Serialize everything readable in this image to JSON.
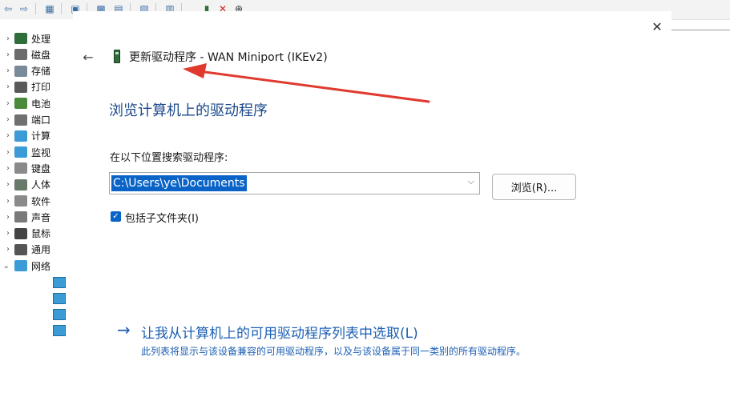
{
  "device_manager": {
    "tree": [
      {
        "label": "处理",
        "expanded": false,
        "color": "#2f6e3a"
      },
      {
        "label": "磁盘",
        "expanded": false,
        "color": "#6b6b6b"
      },
      {
        "label": "存储",
        "expanded": false,
        "color": "#7a8a9a"
      },
      {
        "label": "打印",
        "expanded": false,
        "color": "#5a5a5a"
      },
      {
        "label": "电池",
        "expanded": false,
        "color": "#4a8a3a"
      },
      {
        "label": "端口",
        "expanded": false,
        "color": "#707070"
      },
      {
        "label": "计算",
        "expanded": false,
        "color": "#3a9bd6"
      },
      {
        "label": "监视",
        "expanded": false,
        "color": "#3a9bd6"
      },
      {
        "label": "键盘",
        "expanded": false,
        "color": "#8a8a8a"
      },
      {
        "label": "人体",
        "expanded": false,
        "color": "#6a7a6a"
      },
      {
        "label": "软件",
        "expanded": false,
        "color": "#8a8a8a"
      },
      {
        "label": "声音",
        "expanded": false,
        "color": "#7a7a7a"
      },
      {
        "label": "鼠标",
        "expanded": false,
        "color": "#444444"
      },
      {
        "label": "通用",
        "expanded": false,
        "color": "#555555"
      },
      {
        "label": "网络",
        "expanded": true,
        "color": "#3a9bd6"
      }
    ]
  },
  "dialog": {
    "close_icon": "close-icon",
    "back_icon": "back-arrow-icon",
    "title": "更新驱动程序 - WAN Miniport (IKEv2)",
    "heading": "浏览计算机上的驱动程序",
    "search_label": "在以下位置搜索驱动程序:",
    "path_value": "C:\\Users\\ye\\Documents",
    "browse_label": "浏览(R)...",
    "include_subfolders_label": "包括子文件夹(I)",
    "include_subfolders_checked": true,
    "pick_link": "让我从计算机上的可用驱动程序列表中选取(L)",
    "pick_description": "此列表将显示与该设备兼容的可用驱动程序，以及与该设备属于同一类别的所有驱动程序。"
  },
  "colors": {
    "accent": "#0a64c8",
    "link": "#1c5fb4",
    "heading": "#1c4a8c",
    "annotation_arrow": "#e03a2e"
  }
}
